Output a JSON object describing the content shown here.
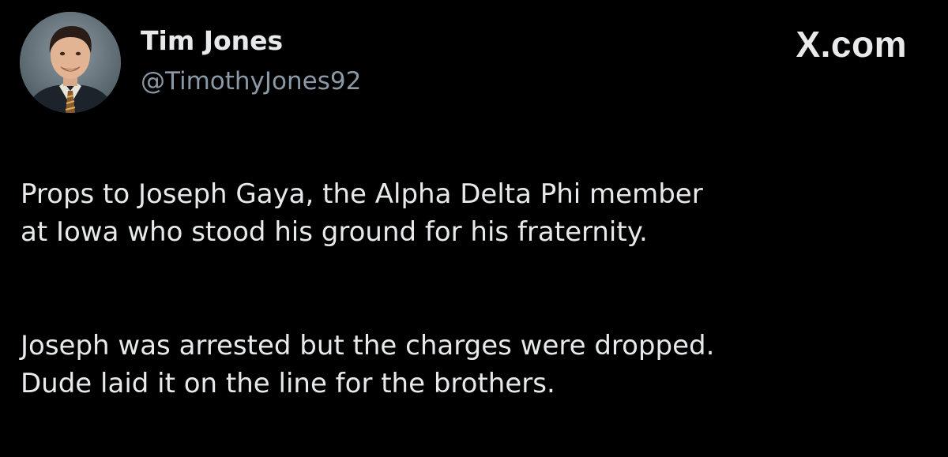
{
  "author": {
    "display_name": "Tim Jones",
    "handle": "@TimothyJones92"
  },
  "brand": {
    "label": "X.com"
  },
  "tweet": {
    "paragraphs": [
      "Props to Joseph Gaya, the Alpha Delta Phi member\nat Iowa who stood his ground for his fraternity.",
      "Joseph was arrested but the charges were dropped.\nDude laid it on the line for the brothers."
    ]
  },
  "colors": {
    "background": "#000000",
    "primary_text": "#e7e9ea",
    "secondary_text": "#8b98a5"
  }
}
